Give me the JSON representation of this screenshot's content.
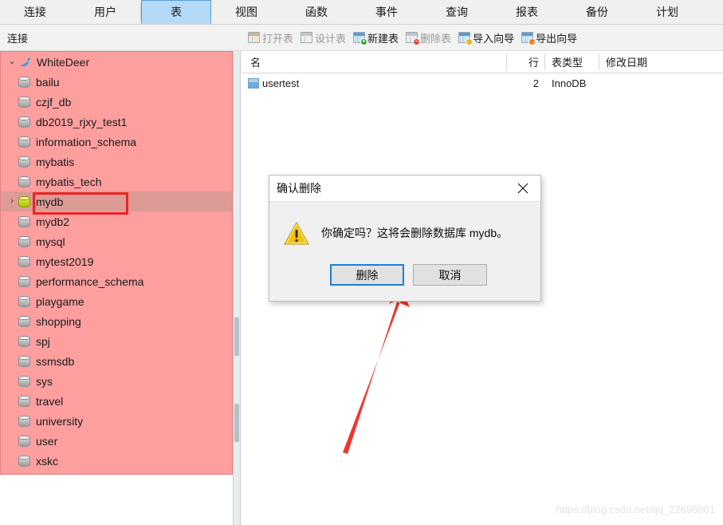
{
  "tabs": [
    {
      "label": "连接",
      "active": false
    },
    {
      "label": "用户",
      "active": false
    },
    {
      "label": "表",
      "active": true
    },
    {
      "label": "视图",
      "active": false
    },
    {
      "label": "函数",
      "active": false
    },
    {
      "label": "事件",
      "active": false
    },
    {
      "label": "查询",
      "active": false
    },
    {
      "label": "报表",
      "active": false
    },
    {
      "label": "备份",
      "active": false
    },
    {
      "label": "计划",
      "active": false
    }
  ],
  "secondbar": {
    "connection_label": "连接",
    "toolbar": [
      {
        "label": "打开表",
        "icon": "open-table-icon",
        "style": "tan",
        "badge": "",
        "disabled": true
      },
      {
        "label": "设计表",
        "icon": "design-table-icon",
        "style": "pale",
        "badge": "",
        "disabled": true
      },
      {
        "label": "新建表",
        "icon": "new-table-icon",
        "style": "blue",
        "badge": "green",
        "disabled": false
      },
      {
        "label": "删除表",
        "icon": "delete-table-icon",
        "style": "pale",
        "badge": "red",
        "disabled": true
      },
      {
        "label": "导入向导",
        "icon": "import-wizard-icon",
        "style": "blue",
        "badge": "yellow",
        "disabled": false
      },
      {
        "label": "导出向导",
        "icon": "export-wizard-icon",
        "style": "blue",
        "badge": "orange",
        "disabled": false
      }
    ]
  },
  "tree": {
    "root": {
      "label": "WhiteDeer",
      "icon": "mysql-dolphin-icon",
      "expanded": true,
      "twisty": "⌄"
    },
    "items": [
      {
        "label": "bailu",
        "selected": false,
        "twisty": "",
        "active_db": false
      },
      {
        "label": "czjf_db",
        "selected": false,
        "twisty": "",
        "active_db": false
      },
      {
        "label": "db2019_rjxy_test1",
        "selected": false,
        "twisty": "",
        "active_db": false
      },
      {
        "label": "information_schema",
        "selected": false,
        "twisty": "",
        "active_db": false
      },
      {
        "label": "mybatis",
        "selected": false,
        "twisty": "",
        "active_db": false
      },
      {
        "label": "mybatis_tech",
        "selected": false,
        "twisty": "",
        "active_db": false
      },
      {
        "label": "mydb",
        "selected": true,
        "twisty": "›",
        "active_db": true
      },
      {
        "label": "mydb2",
        "selected": false,
        "twisty": "",
        "active_db": false
      },
      {
        "label": "mysql",
        "selected": false,
        "twisty": "",
        "active_db": false
      },
      {
        "label": "mytest2019",
        "selected": false,
        "twisty": "",
        "active_db": false
      },
      {
        "label": "performance_schema",
        "selected": false,
        "twisty": "",
        "active_db": false
      },
      {
        "label": "playgame",
        "selected": false,
        "twisty": "",
        "active_db": false
      },
      {
        "label": "shopping",
        "selected": false,
        "twisty": "",
        "active_db": false
      },
      {
        "label": "spj",
        "selected": false,
        "twisty": "",
        "active_db": false
      },
      {
        "label": "ssmsdb",
        "selected": false,
        "twisty": "",
        "active_db": false
      },
      {
        "label": "sys",
        "selected": false,
        "twisty": "",
        "active_db": false
      },
      {
        "label": "travel",
        "selected": false,
        "twisty": "",
        "active_db": false
      },
      {
        "label": "university",
        "selected": false,
        "twisty": "",
        "active_db": false
      },
      {
        "label": "user",
        "selected": false,
        "twisty": "",
        "active_db": false
      },
      {
        "label": "xskc",
        "selected": false,
        "twisty": "",
        "active_db": false
      }
    ]
  },
  "table_list": {
    "columns": {
      "name": "名",
      "rows": "行",
      "type": "表类型",
      "modified": "修改日期"
    },
    "rows": [
      {
        "name": "usertest",
        "rows": "2",
        "type": "InnoDB",
        "modified": ""
      }
    ]
  },
  "dialog": {
    "title": "确认删除",
    "close_glyph": "✕",
    "icon": "warning-triangle-icon",
    "message": "你确定吗？这将会删除数据库 mydb。",
    "confirm_label": "删除",
    "cancel_label": "取消"
  },
  "annotation": {
    "arrow": "red-arrow-pointing-to-delete-button",
    "arrow_color": "#f5342b"
  },
  "watermark": "https://blog.csdn.net/qq_22695001",
  "colors": {
    "tab_active_bg": "#b5daf7",
    "tab_active_border": "#5a9fd4",
    "tree_bg": "#fd9f9f",
    "tree_selected_bg": "#dd9b96",
    "highlight_box": "#ee2222",
    "dialog_bg": "#f0f0f0",
    "primary_button_border": "#1d7fd4",
    "arrow": "#f5342b"
  }
}
